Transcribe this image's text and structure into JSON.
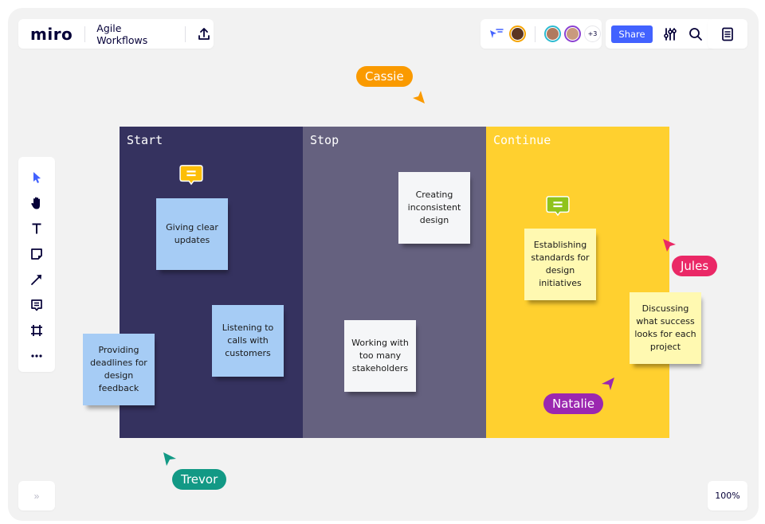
{
  "app": {
    "logo": "miro",
    "board_title": "Agile Workflows"
  },
  "icons": {
    "upload": "upload-icon",
    "follow": "cursor-follow-icon",
    "settings": "sliders-icon",
    "search": "search-icon",
    "notes": "document-icon"
  },
  "collaborators": {
    "avatars": [
      {
        "name": "collaborator-1",
        "ring_color": "#f5a300",
        "face_color": "#5a3522"
      },
      {
        "name": "collaborator-2",
        "ring_color": "#2bbad0",
        "face_color": "#b07a5e"
      },
      {
        "name": "collaborator-3",
        "ring_color": "#8a3fd1",
        "face_color": "#c99a7e"
      }
    ],
    "more_count": "+3"
  },
  "toolbar": {
    "share_label": "Share",
    "tools": [
      "select",
      "hand",
      "text",
      "sticky-note",
      "arrow",
      "comment",
      "frame",
      "more"
    ]
  },
  "bottom": {
    "expand_label": "»",
    "zoom_level": "100%"
  },
  "board": {
    "columns": [
      {
        "title": "Start",
        "color": "#35325f"
      },
      {
        "title": "Stop",
        "color": "#65617f"
      },
      {
        "title": "Continue",
        "color": "#ffd02f"
      }
    ],
    "stickies": {
      "start": [
        "Giving clear updates",
        "Listening to calls with customers",
        "Providing deadlines for design feedback"
      ],
      "stop": [
        "Creating inconsistent design",
        "Working with too many stakeholders"
      ],
      "continue": [
        "Establishing standards for design initiatives",
        "Discussing what success looks for each project"
      ]
    },
    "comment_colors": {
      "start": "#fcbe07",
      "continue": "#8fc31b"
    }
  },
  "cursors": [
    {
      "name": "Cassie",
      "color": "#fa9a00"
    },
    {
      "name": "Jules",
      "color": "#ea2866"
    },
    {
      "name": "Natalie",
      "color": "#9b27b0"
    },
    {
      "name": "Trevor",
      "color": "#129985"
    }
  ]
}
